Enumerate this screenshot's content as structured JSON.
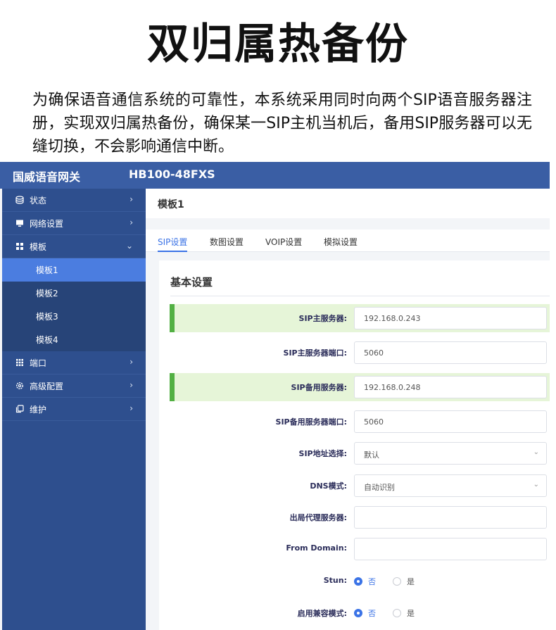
{
  "banner": {
    "title": "双归属热备份",
    "intro": "为确保语音通信系统的可靠性，本系统采用同时向两个SIP语音服务器注册，实现双归属热备份，确保某一SIP主机当机后，备用SIP服务器可以无缝切换，不会影响通信中断。"
  },
  "topbar": {
    "brand": "国威语音网关",
    "model": "HB100-48FXS"
  },
  "sidebar": {
    "items": [
      {
        "label": "状态",
        "icon": "database-icon",
        "chevron": "›"
      },
      {
        "label": "网络设置",
        "icon": "monitor-icon",
        "chevron": "›"
      },
      {
        "label": "模板",
        "icon": "grid-icon",
        "chevron": "⌄"
      },
      {
        "label": "端口",
        "icon": "apps-icon",
        "chevron": "›"
      },
      {
        "label": "高级配置",
        "icon": "gear-icon",
        "chevron": "›"
      },
      {
        "label": "维护",
        "icon": "copy-icon",
        "chevron": "›"
      }
    ],
    "sub_items": [
      {
        "label": "模板1"
      },
      {
        "label": "模板2"
      },
      {
        "label": "模板3"
      },
      {
        "label": "模板4"
      }
    ]
  },
  "page": {
    "title": "模板1"
  },
  "tabs": [
    {
      "label": "SIP设置"
    },
    {
      "label": "数图设置"
    },
    {
      "label": "VOIP设置"
    },
    {
      "label": "模拟设置"
    }
  ],
  "form": {
    "title": "基本设置",
    "fields": [
      {
        "label": "SIP主服务器:",
        "value": "192.168.0.243"
      },
      {
        "label": "SIP主服务器端口:",
        "value": "5060"
      },
      {
        "label": "SIP备用服务器:",
        "value": "192.168.0.248"
      },
      {
        "label": "SIP备用服务器端口:",
        "value": "5060"
      },
      {
        "label": "SIP地址选择:",
        "value": "默认"
      },
      {
        "label": "DNS模式:",
        "value": "自动识别"
      },
      {
        "label": "出局代理服务器:",
        "value": ""
      },
      {
        "label": "From Domain:",
        "value": ""
      }
    ],
    "radios": [
      {
        "label": "Stun:",
        "options": [
          "否",
          "是"
        ],
        "selected": "否"
      },
      {
        "label": "启用兼容模式:",
        "options": [
          "否",
          "是"
        ],
        "selected": "否"
      }
    ]
  },
  "colors": {
    "topbar": "#3a5ea4",
    "sidebar": "#2e4f8e",
    "active": "#4b7de0",
    "highlight": "#e6f5d8",
    "highlight_bar": "#52b043",
    "accent": "#3b73e6"
  }
}
